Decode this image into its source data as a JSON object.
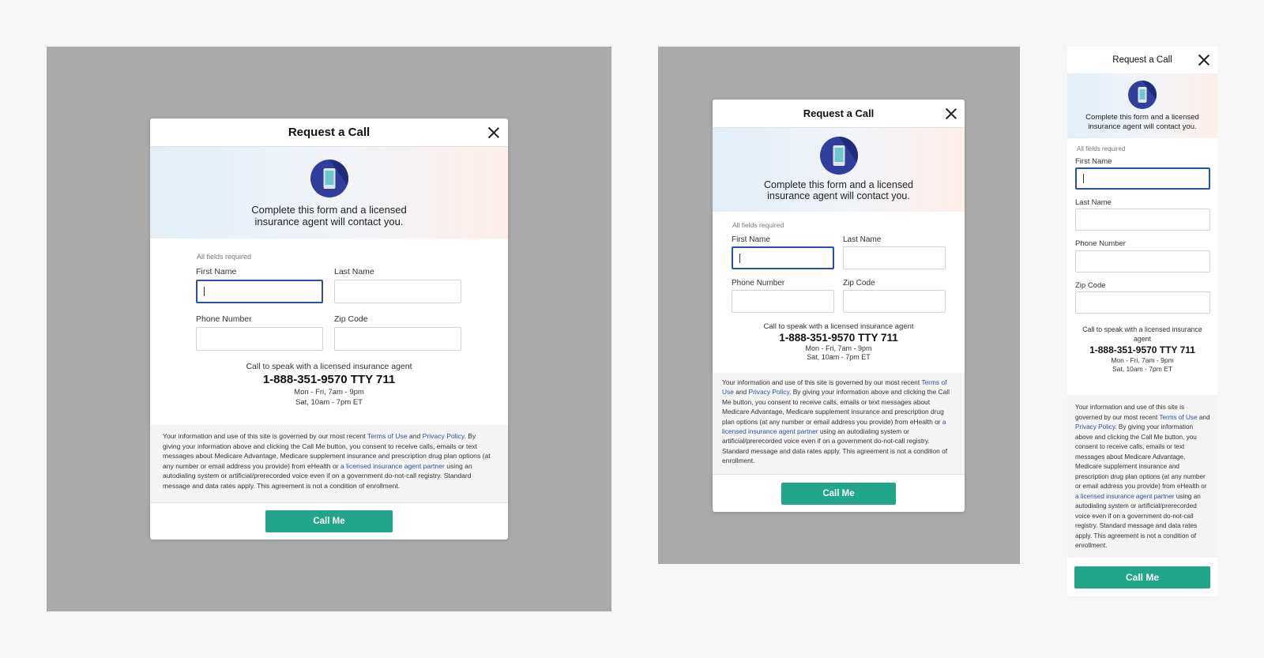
{
  "colors": {
    "backdrop": "#aaaaaa",
    "accent": "#21a68a",
    "focus": "#2c4fa8",
    "link": "#2c4fa8"
  },
  "modal": {
    "title": "Request a Call",
    "hero_line1": "Complete this form and a licensed",
    "hero_line2": "insurance agent will contact you.",
    "required_note": "All fields required",
    "fields": {
      "first_name": "First Name",
      "last_name": "Last Name",
      "phone": "Phone Number",
      "zip": "Zip Code"
    },
    "call": {
      "intro": "Call to speak with a licensed insurance agent",
      "number": "1-888-351-9570 TTY 711",
      "hours1": "Mon - Fri, 7am - 9pm",
      "hours2": "Sat, 10am - 7pm ET"
    },
    "legal": {
      "p1": "Your information and use of this site is governed by our most recent ",
      "terms": "Terms of Use",
      "and": " and ",
      "privacy": "Privacy Policy",
      "p2": ". By giving your information above and clicking the Call Me button, you consent to receive calls, emails or text messages about Medicare Advantage, Medicare supplement insurance and prescription drug plan options (at any number or email address you provide) from eHealth or ",
      "partner": "a licensed insurance agent partner",
      "p3": " using an autodialing system or artificial/prerecorded voice even if on a government do-not-call registry. Standard message and data rates apply. This agreement is not a condition of enrollment."
    },
    "cta": "Call Me",
    "icon": "phone-icon",
    "close_icon": "close-icon"
  }
}
